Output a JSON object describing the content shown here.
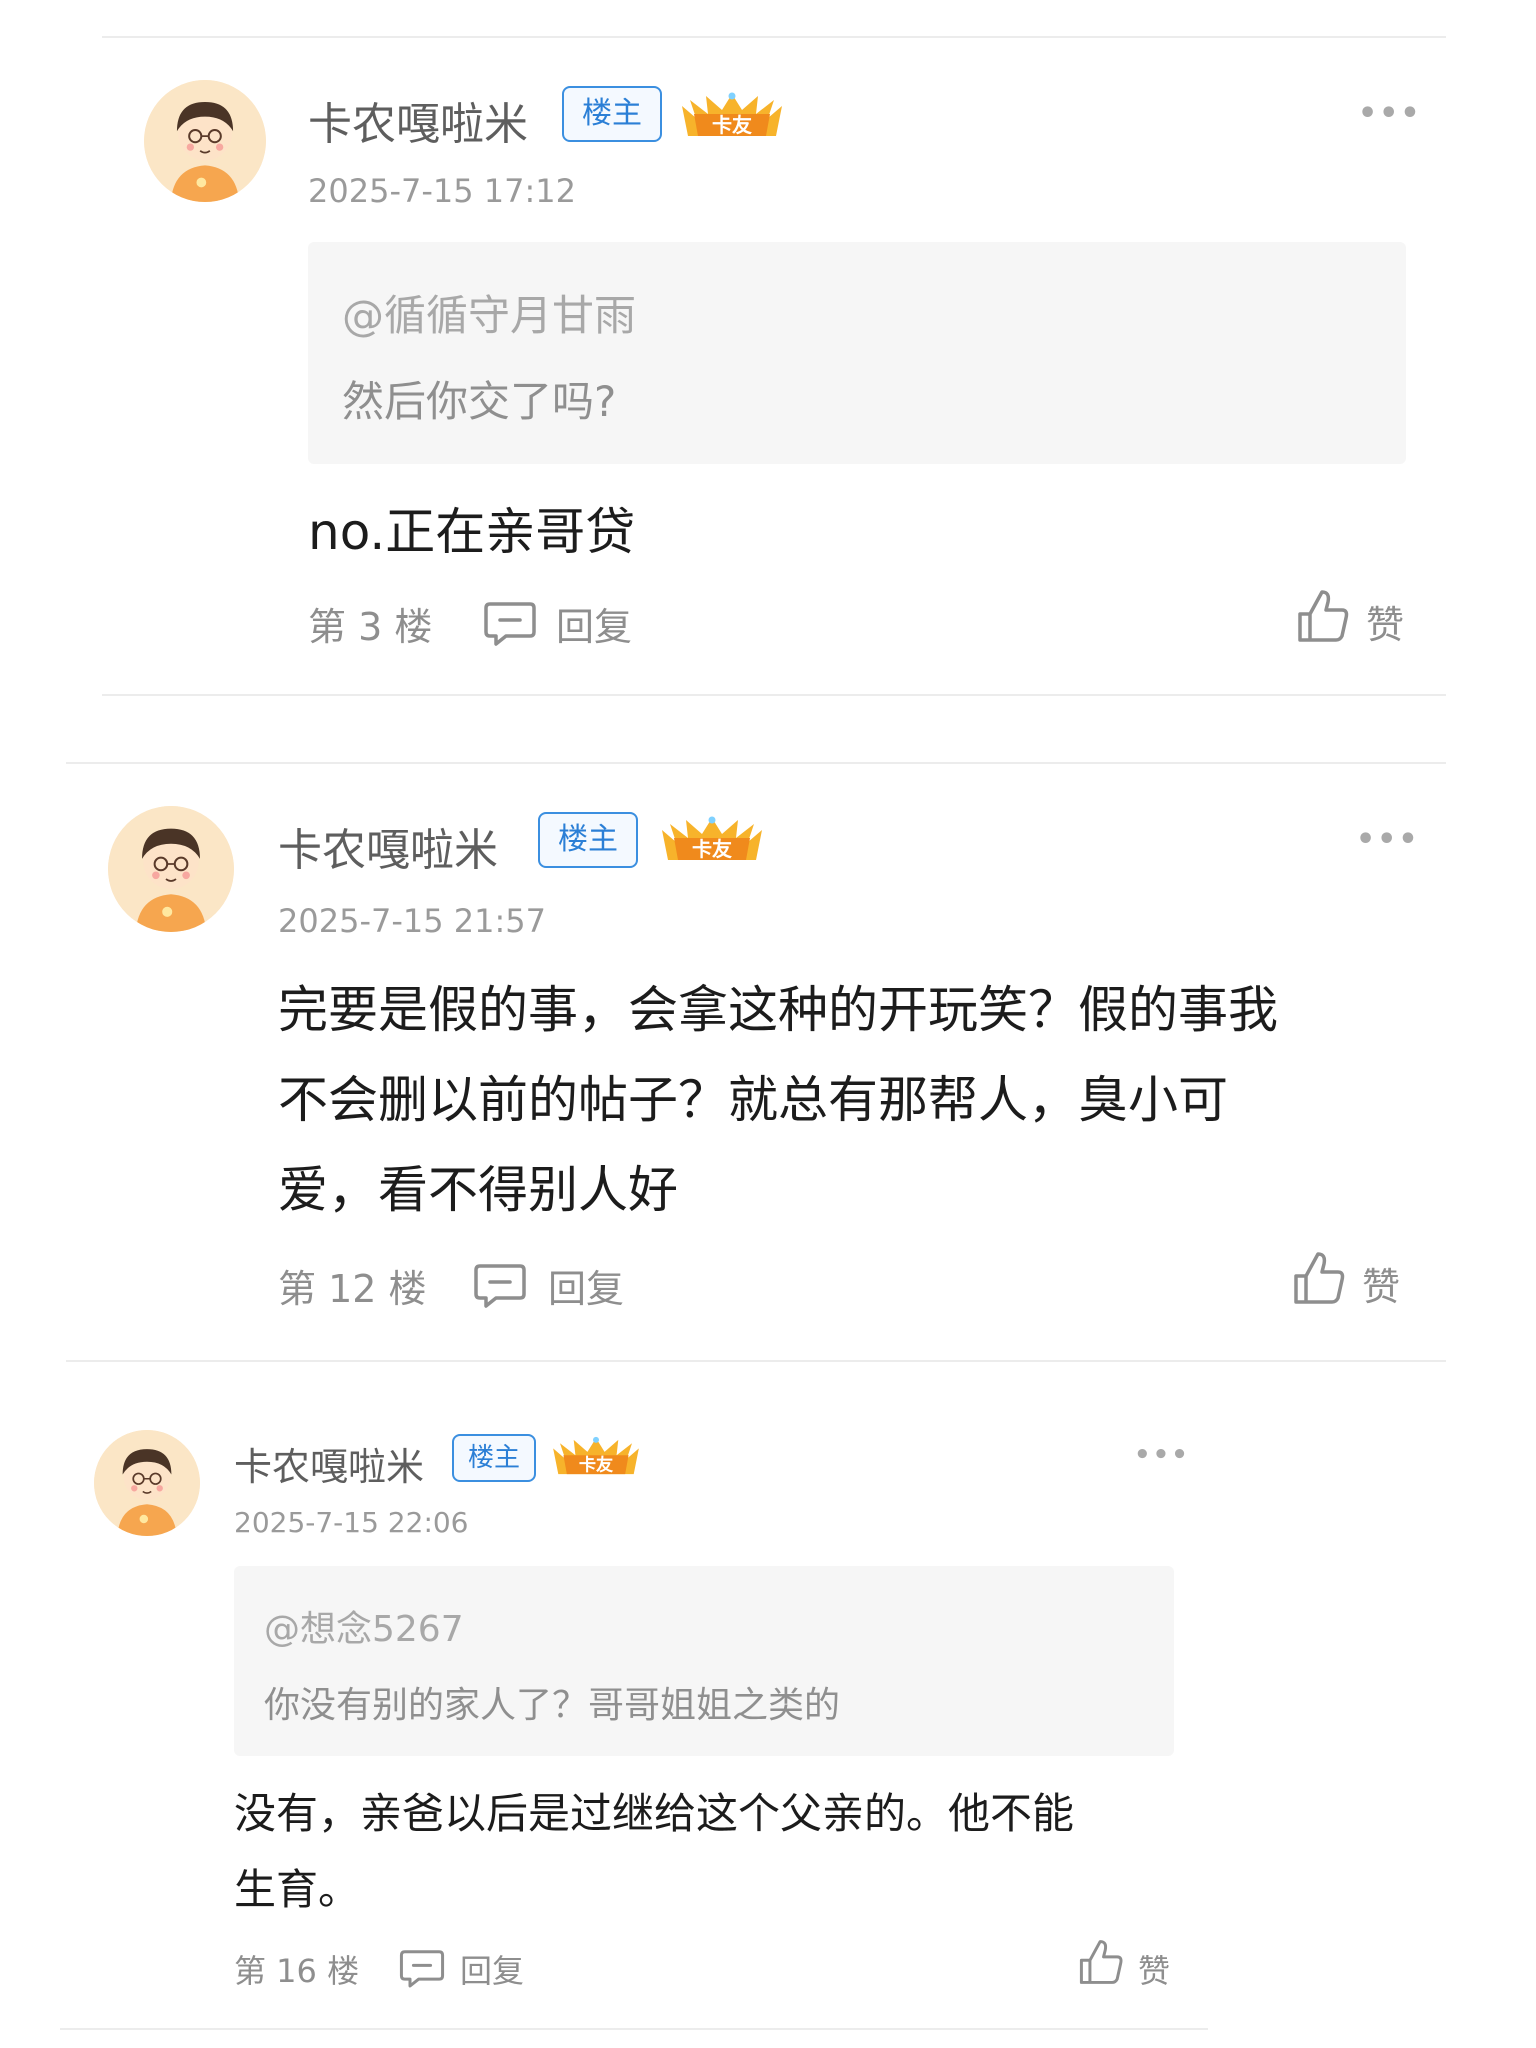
{
  "posts": [
    {
      "username": "卡农嘎啦米",
      "owner_badge": "楼主",
      "fan_badge": "卡友",
      "timestamp": "2025-7-15 17:12",
      "quote_user": "@循循守月甘雨",
      "quote_text": "然后你交了吗?",
      "content": "no.正在亲哥贷",
      "floor": "第 3 楼",
      "reply_label": "回复",
      "like_label": "赞"
    },
    {
      "username": "卡农嘎啦米",
      "owner_badge": "楼主",
      "fan_badge": "卡友",
      "timestamp": "2025-7-15 21:57",
      "content_lines": [
        "完要是假的事，会拿这种的开玩笑？假的事我",
        "不会删以前的帖子？就总有那帮人，臭小可",
        "爱，看不得别人好"
      ],
      "floor": "第 12 楼",
      "reply_label": "回复",
      "like_label": "赞"
    },
    {
      "username": "卡农嘎啦米",
      "owner_badge": "楼主",
      "fan_badge": "卡友",
      "timestamp": "2025-7-15 22:06",
      "quote_user": "@想念5267",
      "quote_text": "你没有别的家人了？哥哥姐姐之类的",
      "content_lines": [
        "没有，亲爸以后是过继给这个父亲的。他不能",
        "生育。"
      ],
      "floor": "第 16 楼",
      "reply_label": "回复",
      "like_label": "赞"
    }
  ],
  "colors": {
    "owner_badge": "#2b7fd6",
    "fan_badge": "#f5a623",
    "divider": "#ececec",
    "quote_bg": "#f6f6f6"
  },
  "icons": {
    "more": "more-dots-icon",
    "reply": "comment-bubble-icon",
    "like": "thumbs-up-icon"
  }
}
